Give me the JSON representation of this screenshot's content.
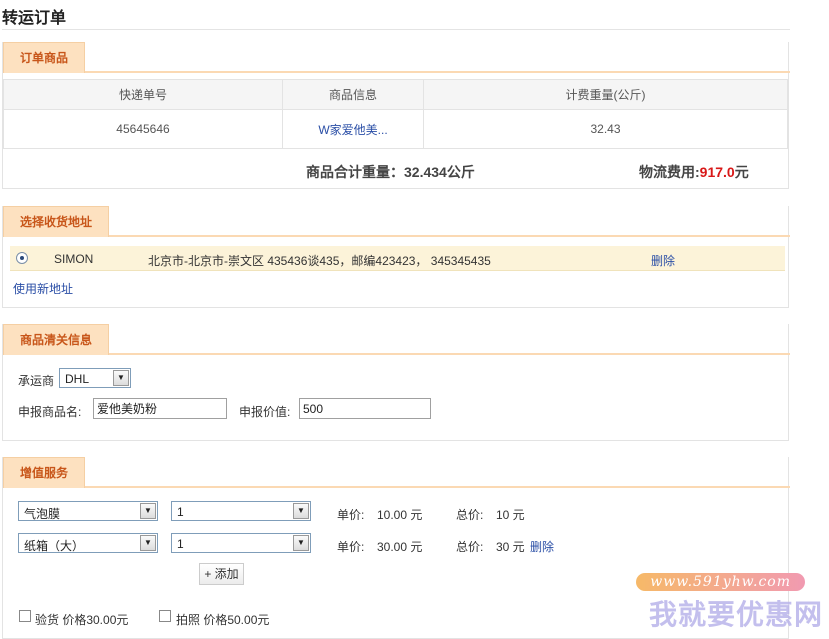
{
  "page": {
    "title": "转运订单"
  },
  "order_goods": {
    "tab": "订单商品",
    "columns": [
      "快递单号",
      "商品信息",
      "计费重量(公斤)"
    ],
    "rows": [
      {
        "tracking_no": "45645646",
        "goods_info": "W家爱他美...",
        "weight": "32.43"
      }
    ],
    "total_weight_label": "商品合计重量：",
    "total_weight_value": "32.434公斤",
    "fee_label": "物流费用:",
    "fee_value": "917.0",
    "fee_unit": "元"
  },
  "address": {
    "tab": "选择收货地址",
    "items": [
      {
        "name": "SIMON",
        "address": "北京市-北京市-崇文区 435436谈435，邮编423423， 345345435",
        "delete_label": "删除",
        "selected": true
      }
    ],
    "new_address_label": "使用新地址"
  },
  "customs": {
    "tab": "商品清关信息",
    "carrier_label": "承运商",
    "carrier_value": "DHL",
    "goods_name_label": "申报商品名:",
    "goods_name_value": "爱他美奶粉",
    "declared_value_label": "申报价值:",
    "declared_value_value": "500"
  },
  "value_added": {
    "tab": "增值服务",
    "services": [
      {
        "item": "气泡膜",
        "qty": "1",
        "unit_price_label": "单价:",
        "unit_price": "10.00 元",
        "total_label": "总价:",
        "total": "10 元",
        "delete_label": ""
      },
      {
        "item": "纸箱（大）",
        "qty": "1",
        "unit_price_label": "单价:",
        "unit_price": "30.00 元",
        "total_label": "总价:",
        "total": "30 元",
        "delete_label": "删除"
      }
    ],
    "add_label": "+ 添加",
    "options": [
      {
        "label": "验货 价格30.00元",
        "checked": false
      },
      {
        "label": "拍照 价格50.00元",
        "checked": false
      }
    ]
  },
  "watermark": {
    "url": "www.591yhw.com",
    "name": "我就要优惠网"
  }
}
